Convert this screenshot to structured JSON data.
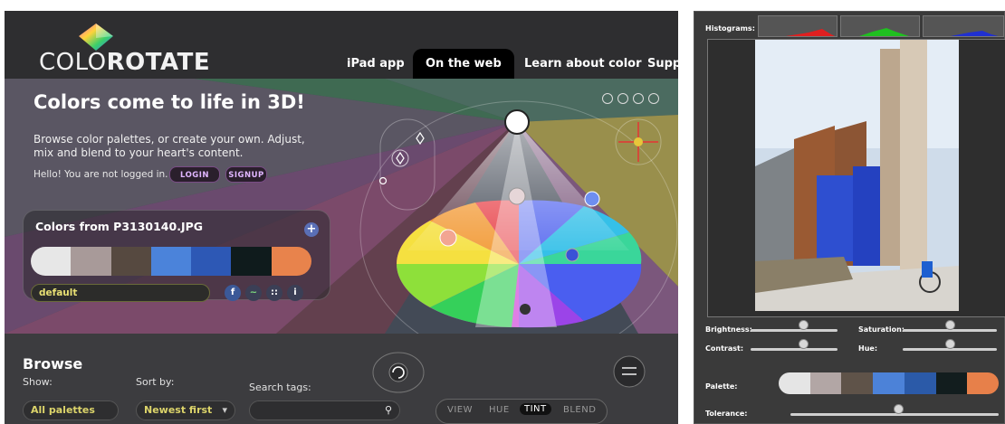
{
  "header": {
    "brand_thin": "COLO",
    "brand_bold": "ROTATE",
    "nav": [
      "iPad app",
      "On the web",
      "Learn about color",
      "Supp"
    ]
  },
  "hero": {
    "title": "Colors come to life in 3D!",
    "subtitle": "Browse color palettes, or create your own. Adjust, mix and blend to your heart's content.",
    "hello": "Hello! You are not logged in.",
    "login_label": "LOGIN",
    "signup_label": "SIGNUP"
  },
  "palette": {
    "title": "Colors from P3130140.JPG",
    "add_symbol": "+",
    "name": "default",
    "swatches": [
      "#e7e7e7",
      "#a89a99",
      "#564940",
      "#4b83da",
      "#2d58b5",
      "#0f1b1c",
      "#e8834c"
    ],
    "share_icons": [
      "f",
      "~",
      "::",
      "i"
    ]
  },
  "browse": {
    "title": "Browse",
    "show_label": "Show:",
    "show_value": "All palettes",
    "sort_label": "Sort by:",
    "sort_value": "Newest first",
    "search_label": "Search tags:",
    "search_value": "",
    "view_tabs": [
      "VIEW",
      "HUE",
      "TINT",
      "BLEND"
    ],
    "active_tab": "TINT"
  },
  "right_panel": {
    "histograms_label": "Histograms:",
    "brightness_label": "Brightness:",
    "saturation_label": "Saturation:",
    "contrast_label": "Contrast:",
    "hue_label": "Hue:",
    "palette_label": "Palette:",
    "tolerance_label": "Tolerance:",
    "swatches": [
      "#e5e5e5",
      "#b2a6a5",
      "#5f5349",
      "#4c82d8",
      "#2b5aa8",
      "#121d1e",
      "#e7804a"
    ],
    "slider_levels": {
      "brightness": 0.5,
      "saturation": 0.5,
      "contrast": 0.5,
      "hue": 0.5,
      "tolerance": 0.5
    }
  }
}
